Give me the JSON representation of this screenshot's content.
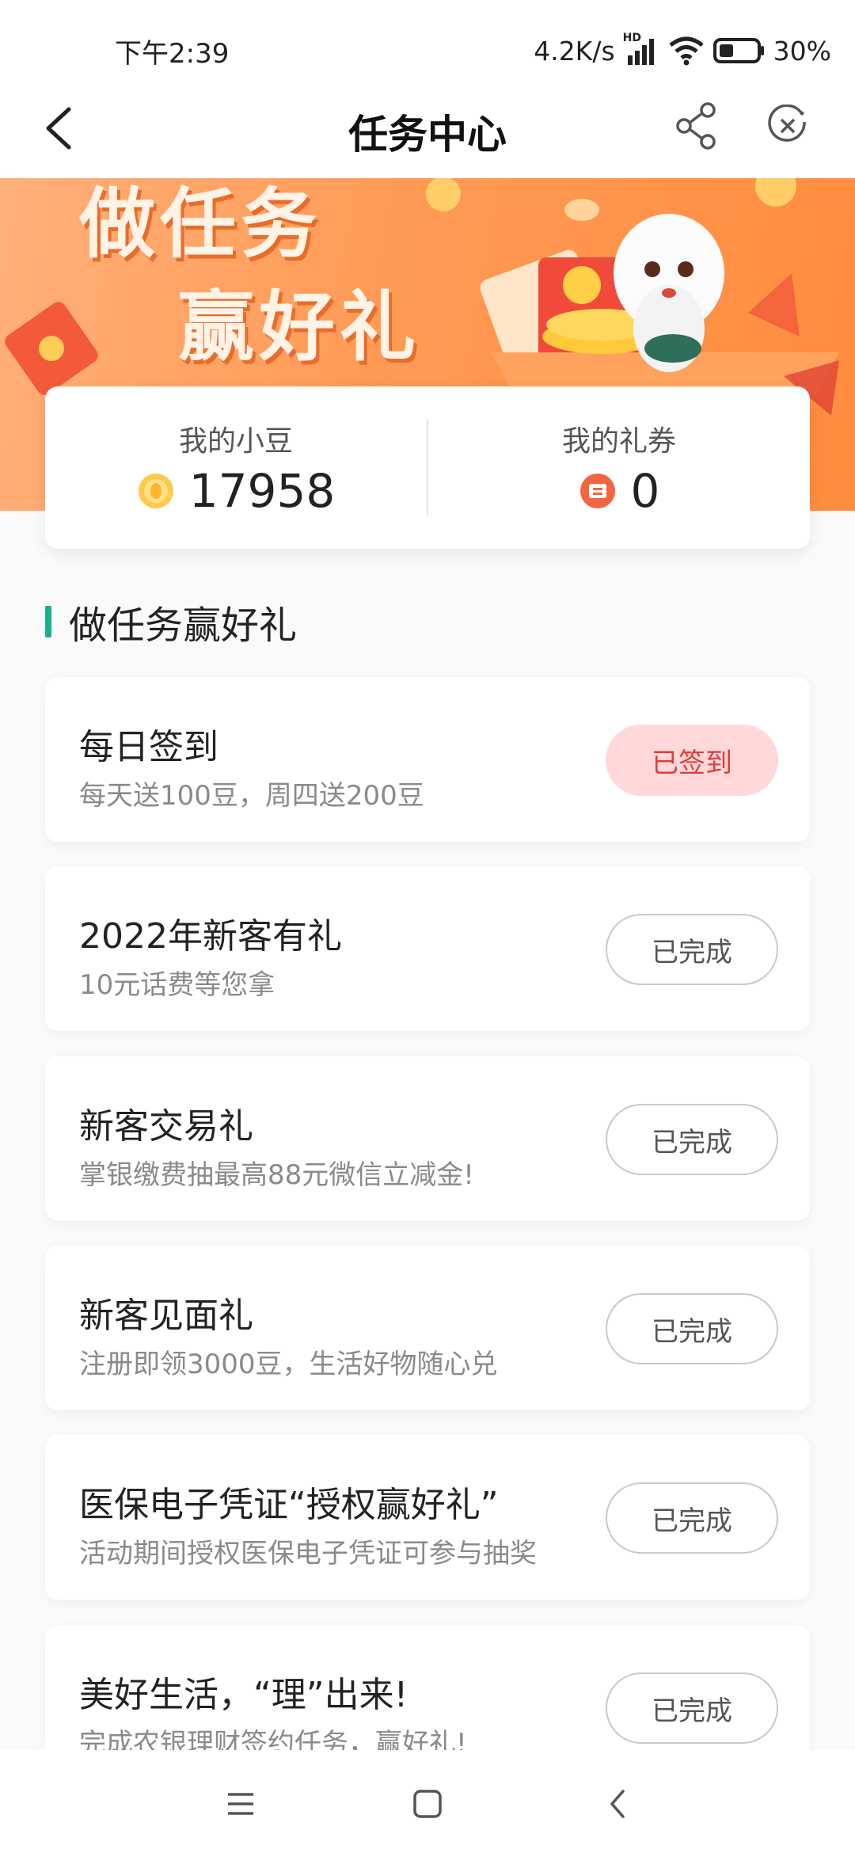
{
  "status_bar": {
    "time": "下午2:39",
    "network_speed": "4.2K/s",
    "network_type": "HD",
    "battery": "30%"
  },
  "nav": {
    "title": "任务中心",
    "back_icon": "back-arrow-icon",
    "share_icon": "share-icon",
    "close_icon": "close-circle-icon"
  },
  "banner": {
    "line1": "做任务",
    "line2": "赢好礼"
  },
  "summary": {
    "beans_label": "我的小豆",
    "beans_value": "17958",
    "coupons_label": "我的礼券",
    "coupons_value": "0"
  },
  "section": {
    "title": "做任务赢好礼"
  },
  "tasks": [
    {
      "name": "每日签到",
      "desc": "每天送100豆，周四送200豆",
      "button": "已签到",
      "state": "checked"
    },
    {
      "name": "2022年新客有礼",
      "desc": "10元话费等您拿",
      "button": "已完成",
      "state": "done"
    },
    {
      "name": "新客交易礼",
      "desc": "掌银缴费抽最高88元微信立减金!",
      "button": "已完成",
      "state": "done"
    },
    {
      "name": "新客见面礼",
      "desc": "注册即领3000豆，生活好物随心兑",
      "button": "已完成",
      "state": "done"
    },
    {
      "name": "医保电子凭证“授权赢好礼”",
      "desc": "活动期间授权医保电子凭证可参与抽奖",
      "button": "已完成",
      "state": "done"
    },
    {
      "name": "美好生活，“理”出来!",
      "desc": "完成农银理财签约任务，赢好礼!",
      "button": "已完成",
      "state": "done"
    }
  ],
  "colors": {
    "accent_green": "#16b28a",
    "banner_orange": "#ff9a55",
    "checked_bg": "#ffd9da",
    "checked_text": "#e43a3a"
  }
}
